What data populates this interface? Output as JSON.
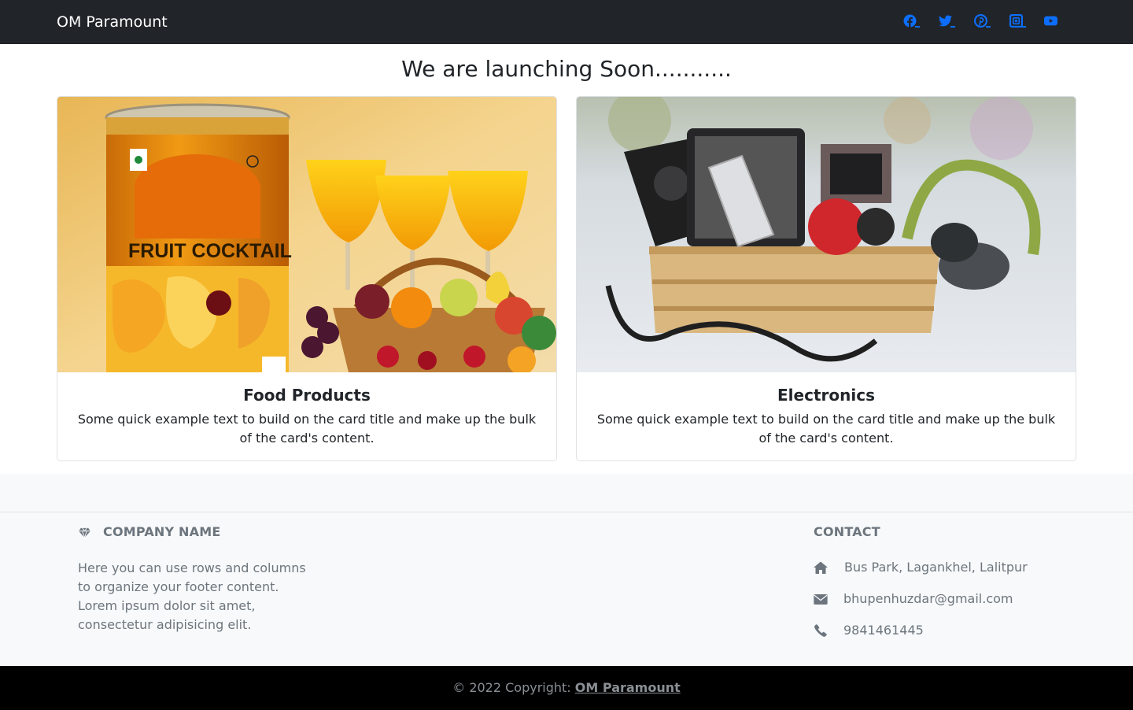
{
  "navbar": {
    "brand": "OM Paramount",
    "social": [
      {
        "name": "facebook",
        "icon": "facebook-icon"
      },
      {
        "name": "twitter",
        "icon": "twitter-icon"
      },
      {
        "name": "pinterest",
        "icon": "pinterest-icon"
      },
      {
        "name": "instagram",
        "icon": "instagram-icon"
      },
      {
        "name": "youtube",
        "icon": "youtube-icon"
      }
    ],
    "accent_color": "#0d6efd"
  },
  "main": {
    "headline": "We are launching Soon...........",
    "cards": [
      {
        "title": "Food Products",
        "text": "Some quick example text to build on the card title and make up the bulk of the card's content.",
        "image_label": "FRUIT COCKTAIL"
      },
      {
        "title": "Electronics",
        "text": "Some quick example text to build on the card title and make up the bulk of the card's content."
      }
    ]
  },
  "footer": {
    "company_heading": "COMPANY NAME",
    "company_text": "Here you can use rows and columns to organize your footer content. Lorem ipsum dolor sit amet, consectetur adipisicing elit.",
    "contact_heading": "CONTACT",
    "address": "Bus Park, Lagankhel, Lalitpur",
    "email": "bhupenhuzdar@gmail.com",
    "phone": "9841461445",
    "copyright_prefix": "© 2022 Copyright:",
    "copyright_link": "OM Paramount"
  }
}
